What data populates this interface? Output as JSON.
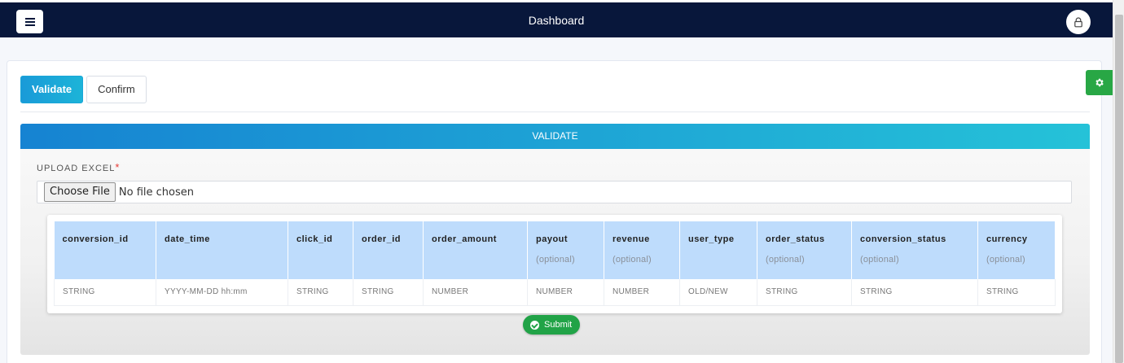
{
  "header": {
    "title": "Dashboard",
    "menu_icon": "hamburger-icon",
    "avatar_icon": "user-lock-icon"
  },
  "tabs": [
    {
      "label": "Validate",
      "active": true
    },
    {
      "label": "Confirm",
      "active": false
    }
  ],
  "section": {
    "title": "VALIDATE",
    "upload_label": "UPLOAD EXCEL",
    "required_mark": "*",
    "file_button": "Choose File",
    "file_status": "No file chosen"
  },
  "table": {
    "columns": [
      {
        "name": "conversion_id",
        "note": ""
      },
      {
        "name": "date_time",
        "note": ""
      },
      {
        "name": "click_id",
        "note": ""
      },
      {
        "name": "order_id",
        "note": ""
      },
      {
        "name": "order_amount",
        "note": ""
      },
      {
        "name": "payout",
        "note": "(optional)"
      },
      {
        "name": "revenue",
        "note": "(optional)"
      },
      {
        "name": "user_type",
        "note": ""
      },
      {
        "name": "order_status",
        "note": "(optional)"
      },
      {
        "name": "conversion_status",
        "note": "(optional)"
      },
      {
        "name": "currency",
        "note": "(optional)"
      }
    ],
    "row": [
      "STRING",
      "YYYY-MM-DD hh:mm",
      "STRING",
      "STRING",
      "NUMBER",
      "NUMBER",
      "NUMBER",
      "OLD/NEW",
      "STRING",
      "STRING",
      "STRING"
    ]
  },
  "submit_label": "Submit",
  "colors": {
    "navbar": "#08173b",
    "primary": "#1a9ad8",
    "success": "#21a347",
    "table_header": "#bedcfc"
  }
}
